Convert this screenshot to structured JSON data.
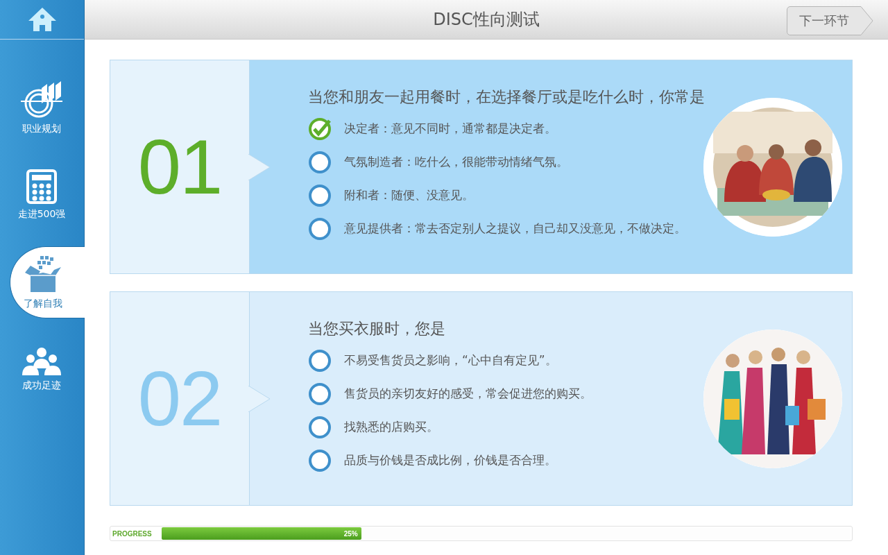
{
  "header": {
    "title": "DISC性向测试",
    "next_button": "下一环节"
  },
  "sidebar": {
    "items": [
      {
        "label": "职业规划",
        "selected": false
      },
      {
        "label": "走进500强",
        "selected": false
      },
      {
        "label": "了解自我",
        "selected": true
      },
      {
        "label": "成功足迹",
        "selected": false
      }
    ]
  },
  "questions": [
    {
      "number": "01",
      "selected": true,
      "text": "当您和朋友一起用餐时，在选择餐厅或是吃什么时，你常是",
      "options": [
        {
          "text": "决定者：意见不同时，通常都是决定者。",
          "checked": true
        },
        {
          "text": "气氛制造者：吃什么，很能带动情绪气氛。",
          "checked": false
        },
        {
          "text": "附和者：随便、没意见。",
          "checked": false
        },
        {
          "text": "意见提供者：常去否定别人之提议，自己却又没意见，不做决定。",
          "checked": false
        }
      ]
    },
    {
      "number": "02",
      "selected": false,
      "text": "当您买衣服时，您是",
      "options": [
        {
          "text": "不易受售货员之影响，“心中自有定见”。",
          "checked": false
        },
        {
          "text": "售货员的亲切友好的感受，常会促进您的购买。",
          "checked": false
        },
        {
          "text": "找熟悉的店购买。",
          "checked": false
        },
        {
          "text": "品质与价钱是否成比例，价钱是否合理。",
          "checked": false
        }
      ]
    }
  ],
  "progress": {
    "label": "PROGRESS",
    "level": 0.29,
    "reading": "25%"
  }
}
